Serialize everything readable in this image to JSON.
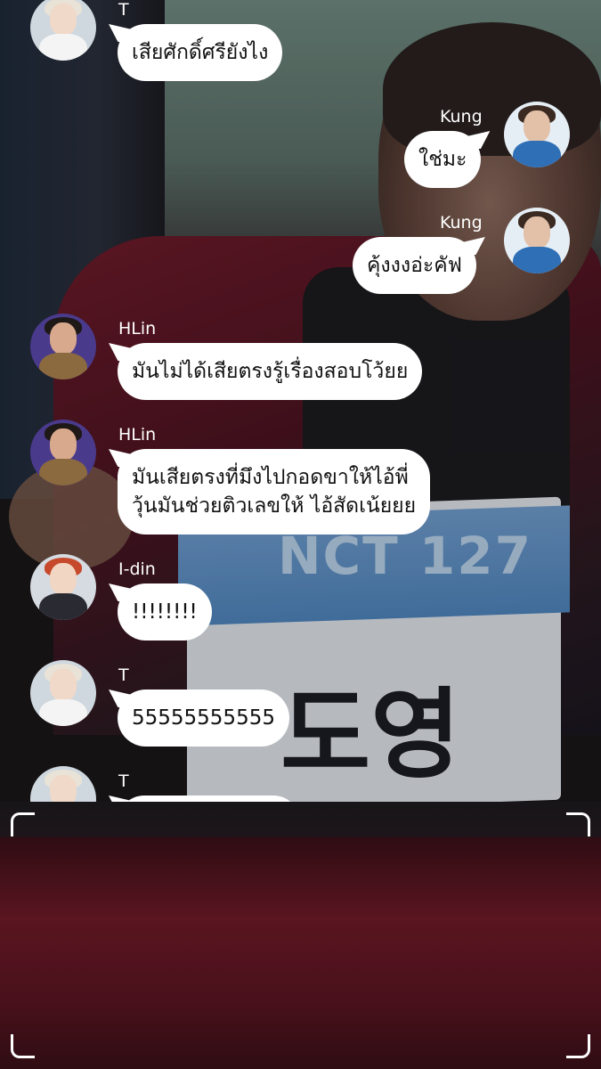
{
  "messages": [
    {
      "sender": "T",
      "side": "left",
      "avatar": "avatar-t",
      "lines": [
        "เสียศักดิ์ศรียังไง"
      ]
    },
    {
      "sender": "Kung",
      "side": "right",
      "avatar": "avatar-kung",
      "lines": [
        "ใช่มะ"
      ]
    },
    {
      "sender": "Kung",
      "side": "right",
      "avatar": "avatar-kung",
      "lines": [
        "คุ้งงงอ่ะคัฟ"
      ]
    },
    {
      "sender": "HLin",
      "side": "left",
      "avatar": "avatar-hlin",
      "lines": [
        "มันไม่ได้เสียตรงรู้เรื่องสอบโว้ยย"
      ]
    },
    {
      "sender": "HLin",
      "side": "left",
      "avatar": "avatar-hlin",
      "lines": [
        "มันเสียตรงที่มึงไปกอดขาให้ไอ้พี่",
        "วุ้นมันช่วยติวเลขให้ ไอ้สัดเน้ยยย"
      ]
    },
    {
      "sender": "I-din",
      "side": "left",
      "avatar": "avatar-idin",
      "lines": [
        "!!!!!!!!"
      ]
    },
    {
      "sender": "T",
      "side": "left",
      "avatar": "avatar-t",
      "lines": [
        "55555555555"
      ]
    },
    {
      "sender": "T",
      "side": "left",
      "avatar": "avatar-t",
      "lines": [
        ""
      ]
    }
  ],
  "background": {
    "bib_text": "NCT 127",
    "bib_name": "도영"
  },
  "colors": {
    "bubble": "#ffffff",
    "name_text": "#ffffff",
    "jacket": "#6d1b2a"
  }
}
